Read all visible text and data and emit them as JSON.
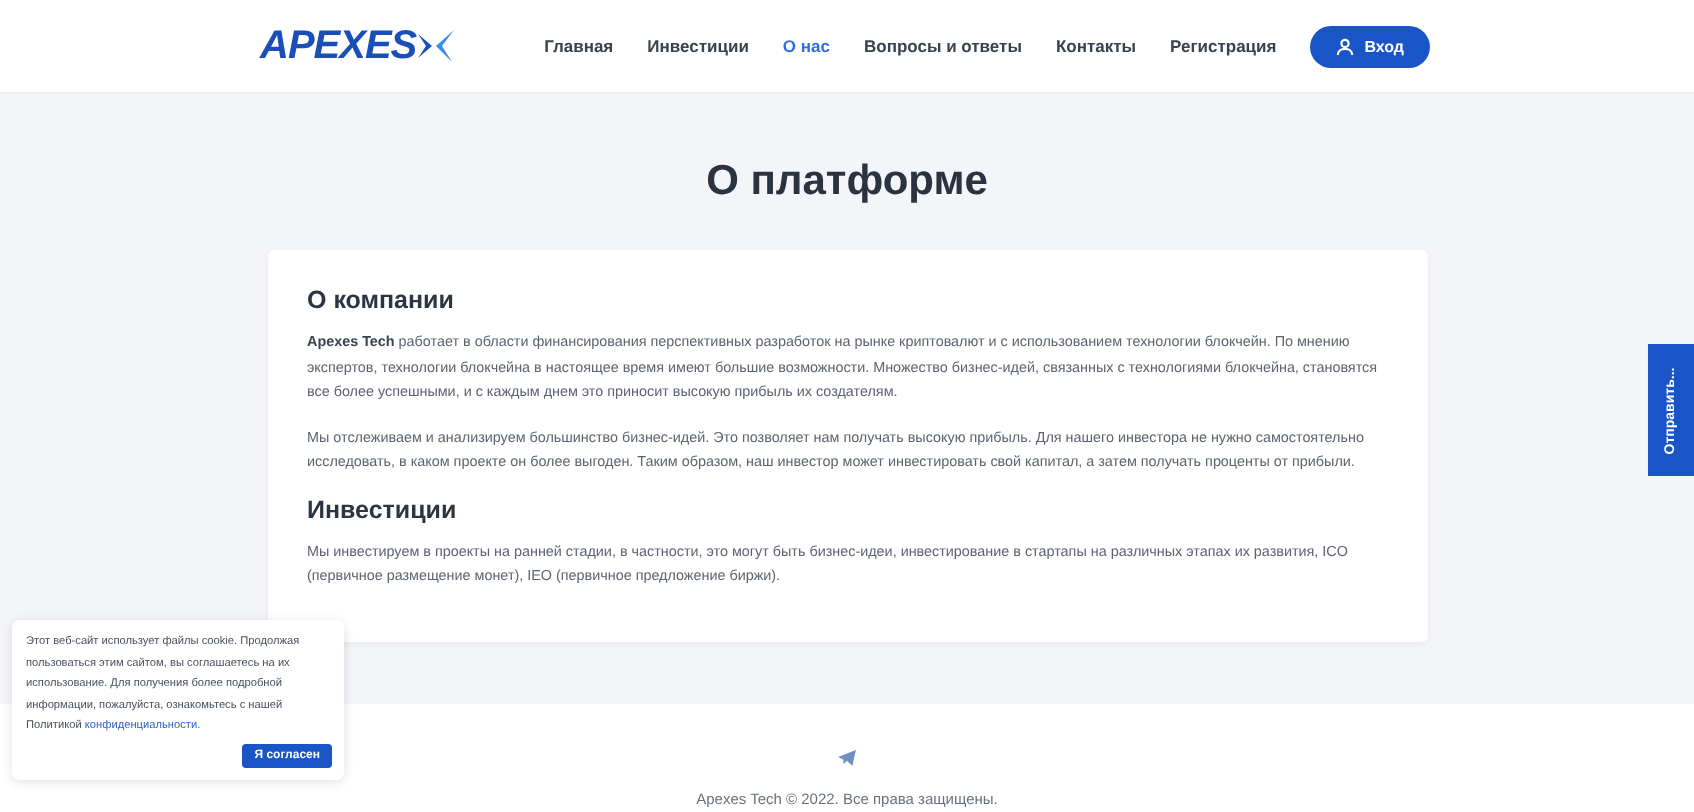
{
  "header": {
    "logo": "APEXES",
    "nav": [
      {
        "label": "Главная",
        "selected": false
      },
      {
        "label": "Инвестиции",
        "selected": false
      },
      {
        "label": "О нас",
        "selected": true
      },
      {
        "label": "Вопросы и ответы",
        "selected": false
      },
      {
        "label": "Контакты",
        "selected": false
      },
      {
        "label": "Регистрация",
        "selected": false
      }
    ],
    "login_button": "Вход"
  },
  "page_title": "О платформе",
  "sections": [
    {
      "heading": "О компании",
      "paragraphs": [
        "**Apexes Tech** работает в области финансирования перспективных разработок на рынке криптовалют и с использованием технологии блокчейн. По мнению экспертов, технологии блокчейна в настоящее время имеют большие возможности. Множество бизнес-идей, связанных с технологиями блокчейна, становятся все более успешными, и с каждым днем это приносит высокую прибыль их создателям.",
        "Мы отслеживаем и анализируем большинство бизнес-идей. Это позволяет нам получать высокую прибыль. Для нашего инвестора не нужно самостоятельно исследовать, в каком проекте он более выгоден. Таким образом, наш инвестор может инвестировать свой капитал, а затем получать проценты от прибыли."
      ]
    },
    {
      "heading": "Инвестиции",
      "paragraphs": [
        "Мы инвестируем в проекты на ранней стадии, в частности, это могут быть бизнес-идеи, инвестирование в стартапы на различных этапах их развития, ICO (первичное размещение монет), IEO (первичное предложение биржи)."
      ]
    }
  ],
  "side_tab": "Отправить...",
  "cookie_notice": {
    "text": "Этот веб-сайт использует файлы cookie. Продолжая пользоваться этим сайтом, вы соглашаетесь на их использование. Для получения более подробной информации, пожалуйста, ознакомьтесь с нашей Политикой",
    "link": "конфиденциальности.",
    "button": "Я согласен"
  },
  "footer": {
    "copyright": "Apexes Tech © 2022. Все права защищены."
  }
}
